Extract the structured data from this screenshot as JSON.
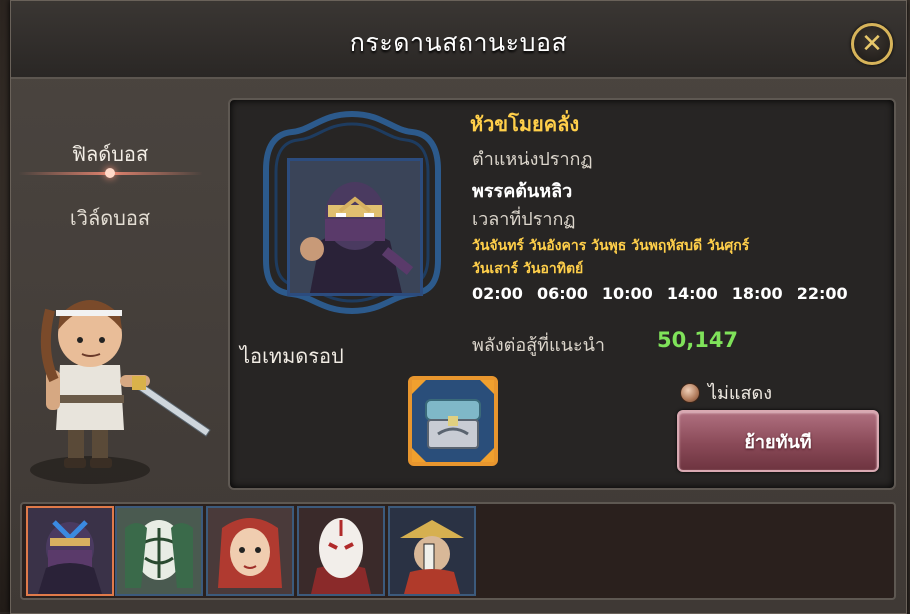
{
  "title": "กระดานสถานะบอส",
  "tabs": {
    "field_boss": "ฟิลด์บอส",
    "world_boss": "เวิล์ดบอส"
  },
  "boss": {
    "name": "หัวขโมยคลั่ง",
    "position_label": "ตำแหน่งปรากฏ",
    "location": "พรรคต้นหลิว",
    "time_label": "เวลาที่ปรากฏ",
    "days_line1": "วันจันทร์ วันอังคาร  วันพุธ วันพฤหัสบดี วันศุกร์",
    "days_line2": "วันเสาร์  วันอาทิตย์",
    "times": [
      "02:00",
      "06:00",
      "10:00",
      "14:00",
      "18:00",
      "22:00"
    ],
    "power_label": "พลังต่อสู้ที่แนะนำ",
    "power_value": "50,147"
  },
  "drop_label": "ไอเทมดรอป",
  "hide_label": "ไม่แสดง",
  "move_button": "ย้ายทันที",
  "colors": {
    "boss_name": "#ffcf4a",
    "power_value": "#7fe25a",
    "button": "#8a4a58",
    "close_ring": "#d7b45a"
  },
  "icons": {
    "close": "close-icon",
    "drop_item": "chest-icon"
  }
}
